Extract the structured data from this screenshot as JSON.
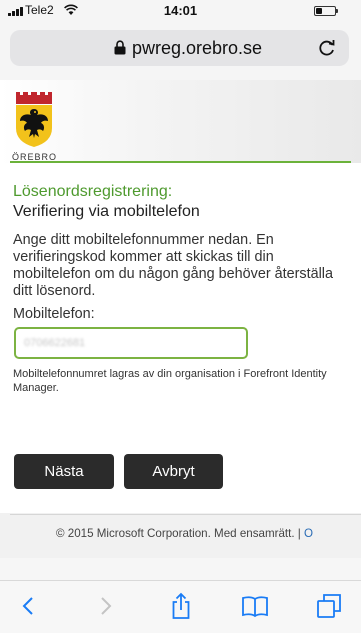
{
  "status_bar": {
    "carrier": "Tele2",
    "time": "14:01"
  },
  "browser": {
    "url": "pwreg.orebro.se"
  },
  "site": {
    "logo_text": "ÖREBRO"
  },
  "form": {
    "section_title": "Lösenordsregistrering:",
    "heading": "Verifiering via mobiltelefon",
    "intro": "Ange ditt mobiltelefonnummer nedan. En verifieringskod kommer att skickas till din mobiltelefon om du någon gång behöver återställa ditt lösenord.",
    "phone_label": "Mobiltelefon:",
    "phone_value": "0706622681",
    "help_text": "Mobiltelefonnumret lagras av din organisation i Forefront Identity Manager.",
    "next_label": "Nästa",
    "cancel_label": "Avbryt"
  },
  "footer": {
    "copyright": "© 2015 Microsoft Corporation. Med ensamrätt.  |",
    "link": " O"
  },
  "colors": {
    "accent_green": "#6bb23a",
    "heading_green": "#4e9a2e",
    "button_bg": "#2b2b2b",
    "safari_blue": "#1a7cf5"
  },
  "icons": [
    "signal-icon",
    "wifi-icon",
    "battery-icon",
    "lock-icon",
    "reload-icon",
    "back-icon",
    "forward-icon",
    "share-icon",
    "bookmarks-icon",
    "tabs-icon"
  ]
}
